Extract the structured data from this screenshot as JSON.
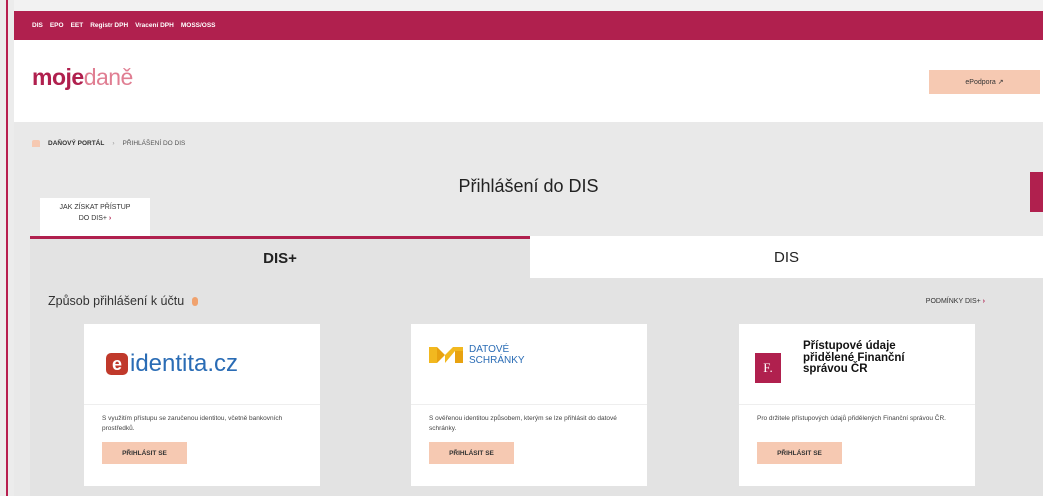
{
  "nav": [
    "DIS",
    "EPO",
    "EET",
    "Registr DPH",
    "Vracení DPH",
    "MOSS/OSS"
  ],
  "logo": {
    "part1": "moje",
    "part2": "daně"
  },
  "epodpora": "ePodpora ↗",
  "breadcrumb": {
    "root": "DAŇOVÝ PORTÁL",
    "sep": "›",
    "current": "PŘIHLÁŠENÍ DO DIS"
  },
  "title": "Přihlášení do DIS",
  "tooltip": {
    "line1": "JAK ZÍSKAT PŘÍSTUP",
    "line2": "DO DIS+",
    "chev": "›"
  },
  "tabs": {
    "active": "DIS+",
    "other": "DIS"
  },
  "panel": {
    "heading": "Způsob přihlášení k účtu",
    "link": "PODMÍNKY DIS+",
    "link_chev": "›"
  },
  "cards": [
    {
      "logo_mark": "e",
      "logo_text": "identita.cz",
      "desc": "S využitím přístupu se zaručenou identitou, včetně bankovních prostředků.",
      "button": "PŘIHLÁSIT SE"
    },
    {
      "logo_line1": "DATOVÉ",
      "logo_line2": "SCHRÁNKY",
      "desc": "S ověřenou identitou způsobem, kterým se lze přihlásit do datové schránky.",
      "button": "PŘIHLÁSIT SE"
    },
    {
      "logo_mark": "F.",
      "logo_text": "Přístupové údaje přidělené Finanční správou ČR",
      "desc": "Pro držitele přístupových údajů přidělených Finanční správou ČR.",
      "button": "PŘIHLÁSIT SE"
    }
  ],
  "colors": {
    "brand": "#b0204e",
    "accent": "#f6c9b2",
    "link_blue": "#2a6cb5"
  }
}
